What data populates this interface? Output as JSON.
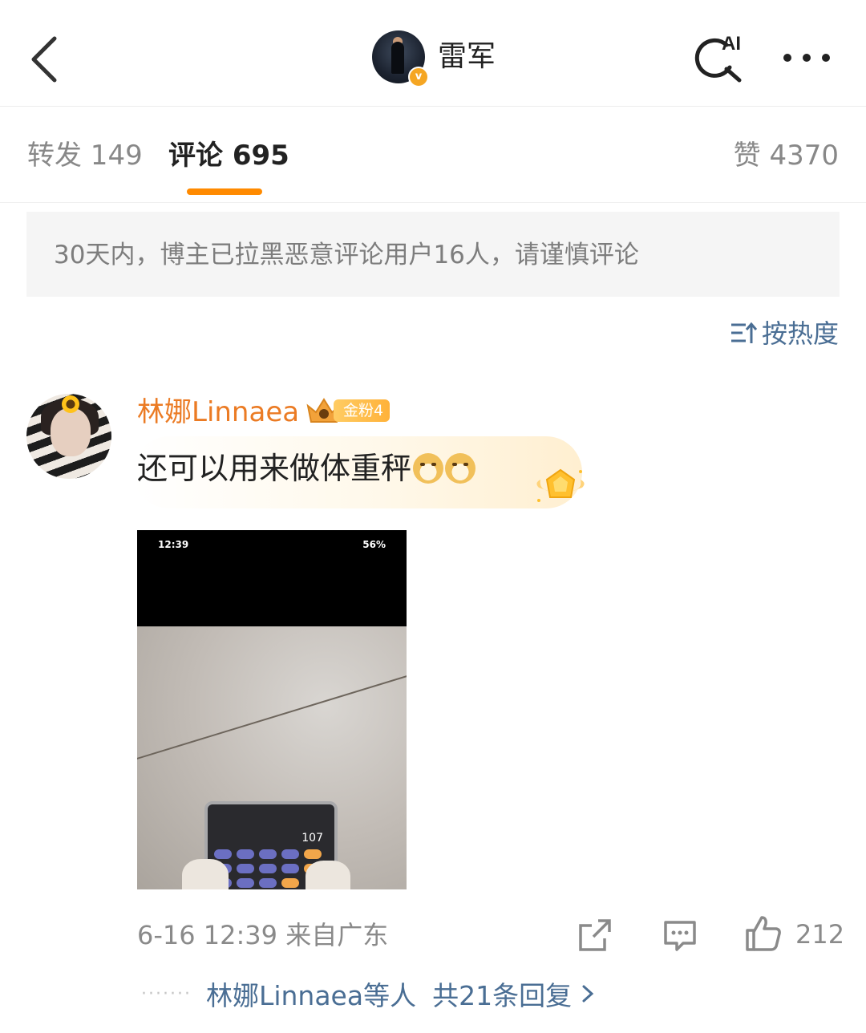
{
  "header": {
    "user_name": "雷军",
    "verify_badge": "v",
    "ai_label": "AI"
  },
  "tabs": {
    "repost": "转发 149",
    "comment": "评论 695",
    "like": "赞 4370",
    "active": "comment"
  },
  "notice": {
    "text": "30天内，博主已拉黑恶意评论用户16人，请谨慎评论"
  },
  "sort": {
    "label": "按热度"
  },
  "comment": {
    "author": "林娜Linnaea",
    "fan_badge": "金粉4",
    "text": "还可以用来做体重秤",
    "image": {
      "status_time": "12:39",
      "battery": "56%",
      "calc_value": "107"
    },
    "meta": "6-16 12:39  来自广东",
    "like_count": "212",
    "replies": {
      "names": "林娜Linnaea等人",
      "total": "共21条回复",
      "dots": "·······"
    }
  },
  "colors": {
    "accent": "#ff8a00",
    "name": "#eb7b24",
    "link": "#4a6e94",
    "muted": "#8a8a8a"
  },
  "icons": [
    "back-arrow-icon",
    "verified-icon",
    "ai-search-icon",
    "more-icon",
    "sort-icon",
    "crown-icon",
    "doge-emoji-icon",
    "gold-medal-icon",
    "share-icon",
    "comment-icon",
    "like-icon",
    "chevron-right-icon"
  ]
}
